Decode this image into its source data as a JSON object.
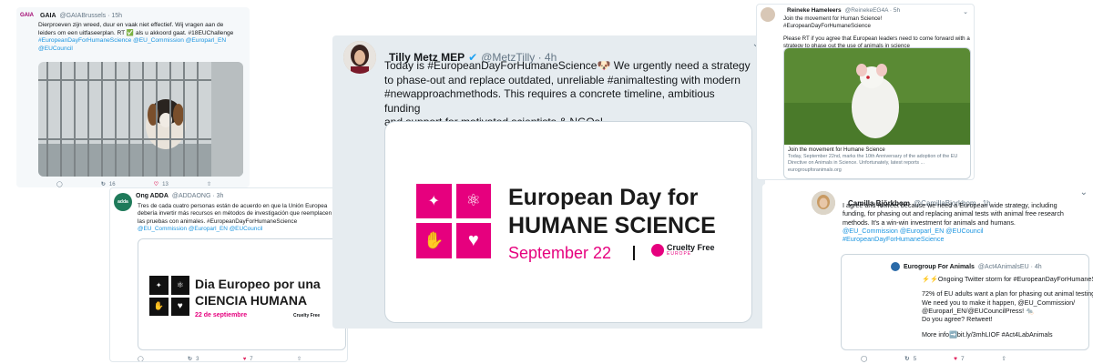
{
  "colors": {
    "link": "#1b95e0",
    "pink": "#e6007e",
    "heart": "#e0245e",
    "muted": "#657786"
  },
  "t1": {
    "name": "GAIA",
    "handle": "@GAIABrussels · 15h",
    "text_lines": [
      "Dierproeven zijn wreed, duur en vaak niet effectief. Wij vragen aan de",
      "leiders om een uitfaseerplan. RT ✅ als u akkoord gaat. #18EUChallenge",
      "#EuropeanDayForHumaneScience @EU_Commission @Europarl_EN",
      "@EUCouncil"
    ],
    "retweets": "16",
    "likes": "13",
    "avatar_text": "GAIA"
  },
  "t2": {
    "name": "Ong ADDA",
    "handle": "@ADDAONG · 3h",
    "text_lines": [
      "Tres de cada cuatro personas están de acuerdo en que la Unión Europea",
      "debería invertir más recursos en métodos de investigación que reemplacen",
      "las pruebas con animales. #EuropeanDayForHumaneScience",
      "@EU_Commission @Europarl_EN @EUCouncil"
    ],
    "card": {
      "line1": "Dia Europeo por una",
      "line2": "CIENCIA HUMANA",
      "date": "22 de septiembre",
      "logo": "Cruelty Free"
    },
    "retweets": "3",
    "likes": "7"
  },
  "t3": {
    "name": "Tilly Metz MEP",
    "handle": "@MetzTilly · 4h",
    "text_lines": [
      "Today is #EuropeanDayForHumaneScience🐶 We urgently need a strategy",
      "to phase-out and replace outdated, unreliable #animaltesting with modern",
      "#newapproachmethods. This requires a concrete timeline, ambitious funding",
      "and support for motivated scientists & NGOs!"
    ],
    "card": {
      "line1": "European Day for",
      "line2": "HUMANE SCIENCE",
      "date": "September 22",
      "logo": "Cruelty Free",
      "logo_sub": "EUROPE"
    }
  },
  "t4": {
    "name": "Reineke Hameleers",
    "handle": "@ReinekeEG4A · 5h",
    "text_lines": [
      "Join the movement for Human Science! #EuropeanDayForHumaneScience",
      "",
      "Please RT if you agree that European leaders need to come forward with a",
      "strategy to phase out the use of animals in science"
    ],
    "card": {
      "title": "Join the movement for Humane Science",
      "desc": "Today, September 22nd, marks the 10th Anniversary of the adoption of the EU Directive on Animals in Science. Unfortunately, latest reports ...",
      "domain": "eurogroupforanimals.org"
    }
  },
  "t5": {
    "name": "Camilla Björkbom",
    "handle": "@CamillaBjorkbom · 1h",
    "text_lines": [
      "I agree and retweet because we need a European wide strategy, including",
      "funding, for phasing out and replacing animal tests with animal free research",
      "methods. It's a win-win investment for animals and humans.",
      "@EU_Commission @Europarl_EN @EUCouncil",
      "#EuropeanDayForHumaneScience"
    ],
    "quote": {
      "name": "Eurogroup For Animals",
      "handle": "@Act4AnimalsEU · 4h",
      "lines": [
        "⚡⚡Ongoing Twitter storm for #EuropeanDayForHumaneScience⚡",
        "",
        "72% of EU adults want a plan for phasing out animal testing.",
        "We need you to make it happen, @EU_Commission/",
        "@Europarl_EN/@EUCouncilPress! 🐀",
        "Do you agree? Retweet!",
        "",
        "More info➡️bit.ly/3mhLIOF  #Act4LabAnimals"
      ]
    },
    "retweets": "5",
    "likes": "7"
  }
}
